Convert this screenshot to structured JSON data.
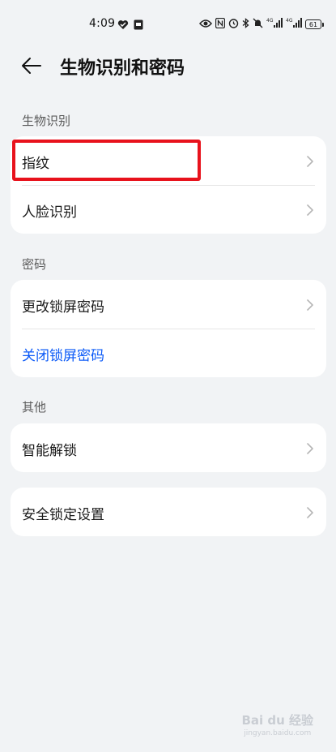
{
  "status_bar": {
    "time": "4:09",
    "battery": "61",
    "icons": [
      "heart-icon",
      "sim-icon",
      "eye-icon",
      "nfc-icon",
      "alarm-icon",
      "bluetooth-icon",
      "mute-icon",
      "signal-icon",
      "signal-icon",
      "battery-icon"
    ],
    "signal_labels": [
      "4G",
      "4G"
    ]
  },
  "header": {
    "title": "生物识别和密码",
    "back_icon": "arrow-left-icon"
  },
  "sections": {
    "biometrics": {
      "label": "生物识别",
      "items": [
        {
          "label": "指纹"
        },
        {
          "label": "人脸识别"
        }
      ]
    },
    "password": {
      "label": "密码",
      "items": [
        {
          "label": "更改锁屏密码"
        },
        {
          "label": "关闭锁屏密码",
          "color": "#0a59f7"
        }
      ]
    },
    "other": {
      "label": "其他",
      "items": [
        {
          "label": "智能解锁"
        }
      ]
    },
    "security": {
      "items": [
        {
          "label": "安全锁定设置"
        }
      ]
    }
  },
  "annotation": {
    "highlight_color": "#e8121c"
  },
  "watermark": {
    "brand": "Bai du 经验",
    "url": "jingyan.baidu.com"
  }
}
